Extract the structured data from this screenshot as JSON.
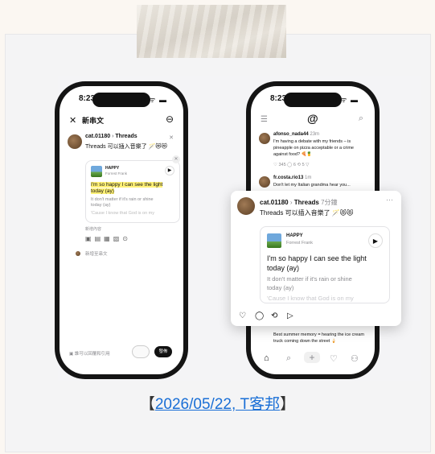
{
  "left_phone": {
    "time": "8:23",
    "status": "..ıl ᯤ ▬",
    "close_glyph": "✕",
    "title": "新串文",
    "more_glyph": "⊖",
    "username": "cat.01180",
    "chevron": "›",
    "community": "Threads",
    "post_text": "Threads 可以插入音樂了 🪄😻😻",
    "song_title": "HAPPY",
    "artist": "Forrest Frank",
    "lyric_highlight_1": "I'm so happy I can see the light",
    "lyric_highlight_2": "today (ay)",
    "lyric_2": "It don't matter if it's rain or shine",
    "lyric_3": "today (ay)",
    "lyric_4": "'Cause I know that God is on my",
    "meta_label": "新增內容",
    "add_placeholder": "新增至串文",
    "bottom_left": "誰可以回覆和引用",
    "post_button": "發佈"
  },
  "right_phone": {
    "time": "8:23",
    "status": "..ıl ᯤ ▬",
    "menu_glyph": "☰",
    "logo": "@",
    "search_glyph": "⌕",
    "post1_user": "afonso_nada44",
    "post1_time": "23m",
    "post1_text_1": "I'm having a debate with my friends – is",
    "post1_text_2": "pineapple on pizza acceptable or a crime",
    "post1_text_3": "against food? 🍕🍍",
    "post1_stats": "♡ 345   ◯ 6   ⟲ 5   ▽",
    "post2_user": "fr.costa.rio13",
    "post2_time": "1m",
    "post2_text": "Don't let my Italian grandma hear you...",
    "post3_text_1": "Best summer memory = hearing the ice cream",
    "post3_text_2": "truck coming down the street 🍦",
    "nav_icons": [
      "⌂",
      "⌕",
      "+",
      "♡",
      "⚇"
    ]
  },
  "popup": {
    "username": "cat.01180",
    "chevron": "›",
    "community": "Threads",
    "time": "7分鐘",
    "more": "···",
    "post_text": "Threads 可以插入音樂了 🪄😻😻",
    "song_title": "HAPPY",
    "artist": "Forrest Frank",
    "lyric_1": "I'm so happy I can see the light",
    "lyric_2": "today (ay)",
    "lyric_3": "It don't matter if it's rain or shine",
    "lyric_4": "today (ay)",
    "lyric_5": "'Cause I know that God is on my",
    "actions": [
      "♡",
      "◯",
      "⟲",
      "▷"
    ]
  },
  "caption": {
    "open": "【",
    "link_text": "2026/05/22, T客邦",
    "close": "】"
  },
  "colors": {
    "link": "#1a6fd6",
    "highlight": "#fff176",
    "background": "#fbf7f2"
  }
}
